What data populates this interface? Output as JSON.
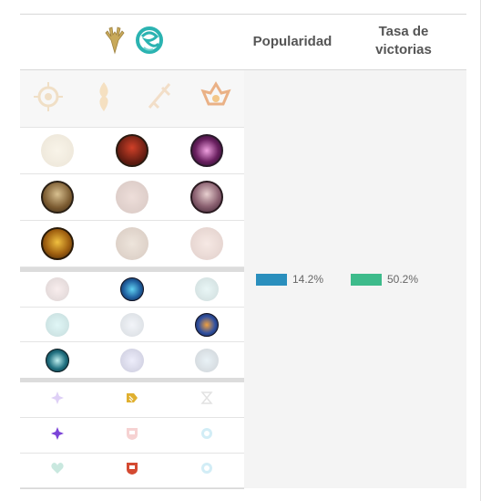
{
  "header": {
    "popularity_label": "Popularidad",
    "winrate_label": "Tasa de victorias",
    "primary_path_icon": "precision-antlers-icon",
    "secondary_path_icon": "inspiration-swirl-icon"
  },
  "rows": {
    "keystones": [
      "keystone-aura-icon",
      "keystone-flame-icon",
      "keystone-sword-icon",
      "keystone-crown-icon"
    ],
    "tier1": [
      "sun-rune-icon",
      "red-warrior-rune-icon",
      "magenta-spark-rune-icon"
    ],
    "tier2": [
      "archer-rune-icon",
      "pale-knight-rune-icon",
      "armored-knight-rune-icon"
    ],
    "tier3": [
      "golden-figure-rune-icon",
      "white-blade-rune-icon",
      "ghost-rune-icon"
    ]
  },
  "stats": {
    "popularity": "14.2%",
    "popularity_value": 14.2,
    "winrate": "50.2%",
    "winrate_value": 50.2,
    "popularity_color": "#2a8fbd",
    "winrate_color": "#3dbb8b"
  },
  "colors": {
    "gold": "#c8a95a",
    "teal": "#2bb3b1",
    "purple": "#7b44d8",
    "red": "#d44a32"
  }
}
